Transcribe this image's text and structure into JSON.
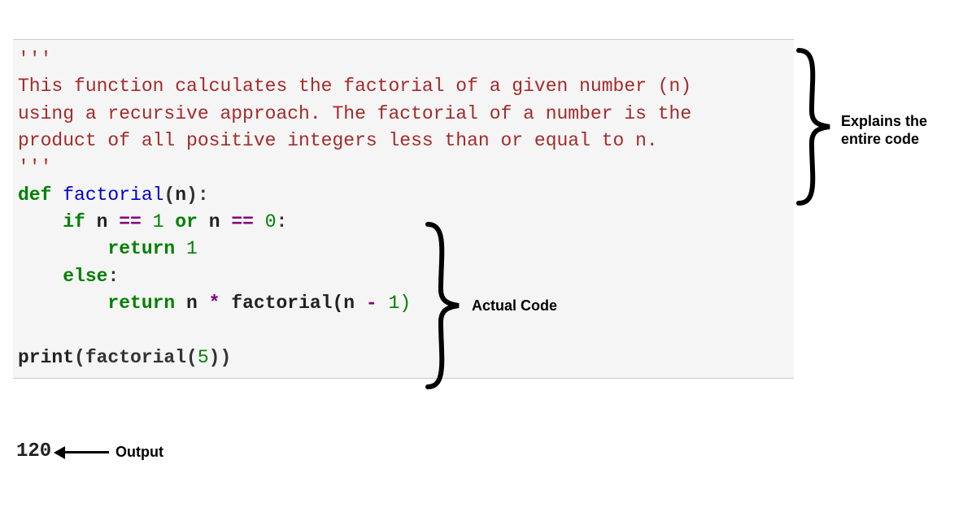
{
  "code": {
    "triple_quote_open": "'''",
    "comment_line1": "This function calculates the factorial of a given number (n)",
    "comment_line2": "using a recursive approach. The factorial of a number is the",
    "comment_line3": "product of all positive integers less than or equal to n.",
    "triple_quote_close": "'''",
    "kw_def": "def",
    "fn_name": " factorial",
    "paren_open": "(",
    "param_n": "n",
    "paren_close_colon": "):",
    "indent1": "    ",
    "kw_if": "if",
    "sp": " ",
    "var_n": "n",
    "op_eq1": " == ",
    "lit_1": "1",
    "kw_or": " or ",
    "op_eq2": " == ",
    "lit_0": "0",
    "colon": ":",
    "indent2": "        ",
    "kw_return": "return",
    "ret_1": " 1",
    "kw_else": "else",
    "ret_expr_pre": " n ",
    "op_mul": "*",
    "call_fact": " factorial(n ",
    "op_minus": "-",
    "tail": " 1)",
    "blank": "",
    "print_call_pre": "print",
    "print_arg_open": "(factorial(",
    "lit_5": "5",
    "print_arg_close": "))"
  },
  "output": "120",
  "annotations": {
    "explains": "Explains the\nentire code",
    "actual_code": "Actual Code",
    "output_label": "Output"
  }
}
